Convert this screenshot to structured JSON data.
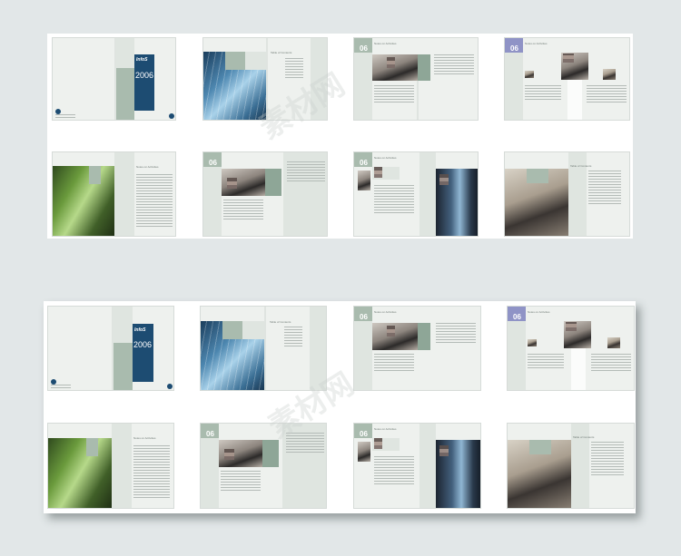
{
  "brochure": {
    "cover_year": "2006",
    "cover_brand": "InfoS",
    "section_number": "06",
    "toc_heading": "Table of Contents",
    "section_heading": "Notes on Activities"
  },
  "colors": {
    "background": "#e2e7e8",
    "board": "#ffffff",
    "sage": "#a9bbae",
    "navy": "#1d4c72",
    "lavender": "#8f93c6"
  },
  "watermark": {
    "top": "素材网",
    "bottom": "素材网"
  }
}
